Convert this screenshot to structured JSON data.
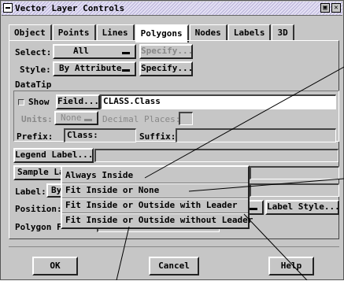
{
  "window": {
    "title": "Vector Layer Controls"
  },
  "tabs": [
    "Object",
    "Points",
    "Lines",
    "Polygons",
    "Nodes",
    "Labels",
    "3D"
  ],
  "select": {
    "label": "Select:",
    "value": "All",
    "specify": "Specify..."
  },
  "style": {
    "label": "Style:",
    "value": "By Attribute",
    "specify": "Specify..."
  },
  "datatip": {
    "heading": "DataTip",
    "show": "Show",
    "field_button": "Field...",
    "field_value": "CLASS.Class",
    "units_label": "Units:",
    "units_value": "None",
    "decimal_label": "Decimal Places:",
    "decimal_value": "",
    "prefix_label": "Prefix:",
    "prefix_value": "Class:",
    "suffix_label": "Suffix:",
    "suffix_value": ""
  },
  "legend_label_button": "Legend Label...",
  "sample_label_button": "Sample La",
  "label_row": {
    "label": "Label:",
    "value": "By"
  },
  "position_row": {
    "label": "Position:",
    "style_button": "Label Style..."
  },
  "polygon_row": {
    "label": "Polygon F"
  },
  "position_menu": {
    "items": [
      "Always Inside",
      "Fit Inside or None",
      "Fit Inside or Outside with Leader",
      "Fit Inside or Outside without Leader"
    ]
  },
  "footer": {
    "ok": "OK",
    "cancel": "Cancel",
    "help": "Help"
  }
}
